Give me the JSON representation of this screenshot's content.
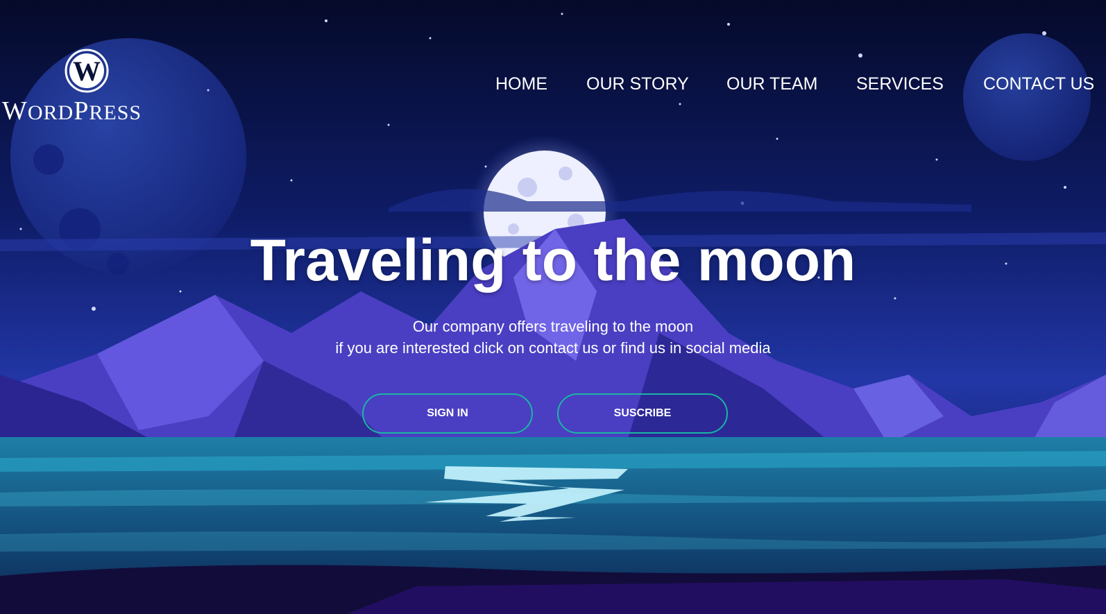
{
  "brand": {
    "logo_text": "WordPress",
    "logo_icon": "wordpress-logo-icon"
  },
  "nav": {
    "items": [
      {
        "label": "HOME"
      },
      {
        "label": "OUR STORY"
      },
      {
        "label": "OUR TEAM"
      },
      {
        "label": "SERVICES"
      },
      {
        "label": "CONTACT US"
      }
    ]
  },
  "hero": {
    "title": "Traveling to the moon",
    "subtitle_line1": "Our company offers traveling to the moon",
    "subtitle_line2": "if you are interested click on contact us or find us in social media"
  },
  "buttons": {
    "sign_in": "SIGN IN",
    "subscribe": "SUSCRIBE"
  },
  "colors": {
    "sky_top": "#060b2c",
    "sky_mid": "#1a2a8a",
    "mountain": "#5b4fd6",
    "water": "#1f7ea8",
    "button_border": "#19b7a2"
  }
}
